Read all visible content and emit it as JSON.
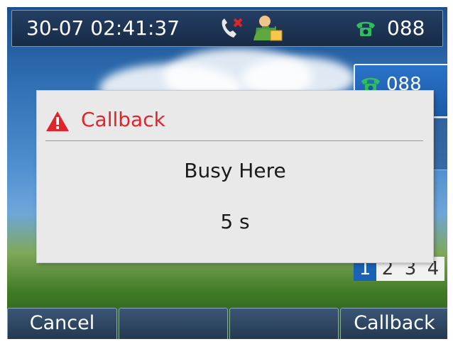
{
  "status_bar": {
    "datetime": "30-07 02:41:37",
    "line": "088",
    "icons": [
      "missed-call-icon",
      "contact-icon",
      "phone-icon"
    ]
  },
  "line_key": {
    "label": "088",
    "icon": "phone-icon"
  },
  "pages": [
    "1",
    "2",
    "3",
    "4"
  ],
  "dialog": {
    "title": "Callback",
    "icon": "warning-icon",
    "message": "Busy Here",
    "countdown": "5 s"
  },
  "softkeys": [
    "Cancel",
    "",
    "",
    "Callback"
  ],
  "colors": {
    "title_red": "#e0242a",
    "phone_green": "#2fbf5a",
    "page_active": "#1a62b5"
  }
}
